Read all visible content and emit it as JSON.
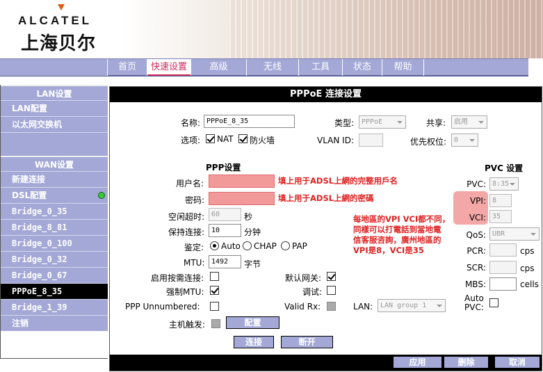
{
  "brand": {
    "name": "ALCATEL",
    "sub": "上海贝尔"
  },
  "nav": {
    "items": [
      "首页",
      "快速设置",
      "高级",
      "无线",
      "工具",
      "状态",
      "帮助"
    ],
    "active": "快速设置"
  },
  "sidebar": {
    "lan_header": "LAN设置",
    "lan_items": [
      "LAN配置",
      "以太网交换机"
    ],
    "wan_header": "WAN设置",
    "wan_items": [
      "新建连接",
      "DSL配置",
      "Bridge_0_35",
      "Bridge_8_81",
      "Bridge_0_100",
      "Bridge_0_32",
      "Bridge_0_67",
      "PPPoE_8_35",
      "Bridge_1_39"
    ],
    "active": "PPPoE_8_35",
    "logout": "注销"
  },
  "form": {
    "title": "PPPoE 连接设置",
    "name_label": "名称:",
    "name_value": "PPPoE_8_35",
    "type_label": "类型:",
    "type_value": "PPPoE",
    "share_label": "共享:",
    "share_value": "启用",
    "options_label": "选项:",
    "nat_label": "NAT",
    "firewall_label": "防火墙",
    "vlan_label": "VLAN ID:",
    "priority_label": "优先权位:",
    "priority_value": "0",
    "ppp_section": "PPP设置",
    "username_label": "用户名:",
    "password_label": "密码:",
    "idle_label": "空闲超时:",
    "idle_value": "60",
    "idle_unit": "秒",
    "keepalive_label": "保持连接:",
    "keepalive_value": "10",
    "keepalive_unit": "分钟",
    "auth_label": "鉴定:",
    "auth_options": [
      "Auto",
      "CHAP",
      "PAP"
    ],
    "mtu_label": "MTU:",
    "mtu_value": "1492",
    "mtu_unit": "字节",
    "on_demand_label": "启用按需连接:",
    "default_gw_label": "默认网关:",
    "force_mtu_label": "强制MTU:",
    "debug_label": "调试:",
    "ppp_unnumbered_label": "PPP Unnumbered:",
    "valid_rx_label": "Valid Rx:",
    "lan_label": "LAN:",
    "lan_value": "LAN group 1",
    "host_trigger_label": "主机触发:",
    "config_button": "配置",
    "connect_button": "连接",
    "disconnect_button": "断开",
    "pvc_section": "PVC 设置",
    "pvc_label": "PVC:",
    "pvc_value": "8:35",
    "vpi_label": "VPI:",
    "vpi_value": "8",
    "vci_label": "VCI:",
    "vci_value": "35",
    "qos_label": "QoS:",
    "qos_value": "UBR",
    "pcr_label": "PCR:",
    "pcr_unit": "cps",
    "scr_label": "SCR:",
    "scr_unit": "cps",
    "mbs_label": "MBS:",
    "mbs_unit": "cells",
    "auto_pvc_label": "Auto PVC:",
    "apply_button": "应用",
    "delete_button": "删除",
    "cancel_button": "取消"
  },
  "annotations": {
    "username_note": "填上用于ADSL上網的完整用戶名",
    "password_note": "填上用于ADSL上網的密碼",
    "vpi_note": [
      "每地區的VPI VCI都不同，",
      "同樣可以打電話到當地電",
      "信客服咨詢，廣州地區的",
      "VPI是8，VCI是35"
    ]
  },
  "colors": {
    "nav": "#a3a8d6",
    "accent": "#cc2a5a",
    "annotation": "#e02020",
    "highlight": "#f3a7a7"
  }
}
